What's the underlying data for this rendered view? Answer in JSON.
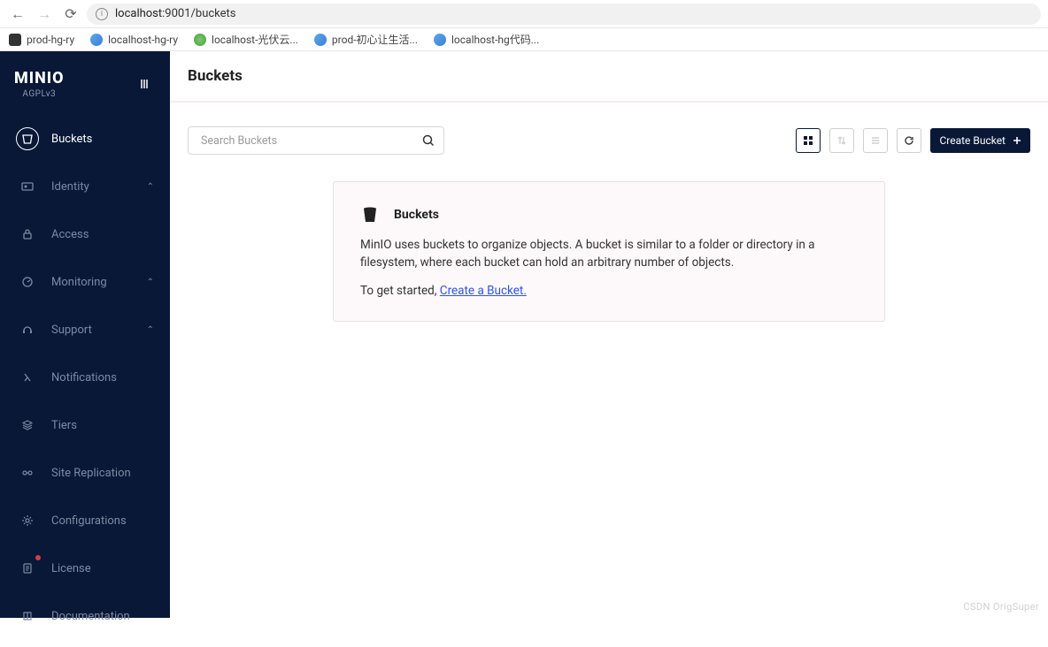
{
  "browser": {
    "url_host": "localhost",
    "url_rest": ":9001/buckets",
    "bookmarks": [
      {
        "label": "prod-hg-ry",
        "fav": "dark"
      },
      {
        "label": "localhost-hg-ry",
        "fav": "blue"
      },
      {
        "label": "localhost-光伏云...",
        "fav": "green"
      },
      {
        "label": "prod-初心让生活...",
        "fav": "blue"
      },
      {
        "label": "localhost-hg代码...",
        "fav": "blue"
      }
    ]
  },
  "sidebar": {
    "logo": "MINIO",
    "license_tag": "AGPLv3",
    "items": [
      {
        "label": "Buckets",
        "icon": "bucket",
        "active": true
      },
      {
        "label": "Identity",
        "icon": "id",
        "expandable": true
      },
      {
        "label": "Access",
        "icon": "lock"
      },
      {
        "label": "Monitoring",
        "icon": "chart",
        "expandable": true
      },
      {
        "label": "Support",
        "icon": "headset",
        "expandable": true
      },
      {
        "label": "Notifications",
        "icon": "lambda"
      },
      {
        "label": "Tiers",
        "icon": "layers"
      },
      {
        "label": "Site Replication",
        "icon": "replicate"
      },
      {
        "label": "Configurations",
        "icon": "gear"
      },
      {
        "label": "License",
        "icon": "doc",
        "dot": true
      },
      {
        "label": "Documentation",
        "icon": "book"
      }
    ]
  },
  "page": {
    "title": "Buckets",
    "search_placeholder": "Search Buckets",
    "create_label": "Create Bucket"
  },
  "empty": {
    "title": "Buckets",
    "desc": "MinIO uses buckets to organize objects. A bucket is similar to a folder or directory in a filesystem, where each bucket can hold an arbitrary number of objects.",
    "getstart_prefix": "To get started, ",
    "link": "Create a Bucket."
  },
  "watermark": "CSDN OrigSuper"
}
